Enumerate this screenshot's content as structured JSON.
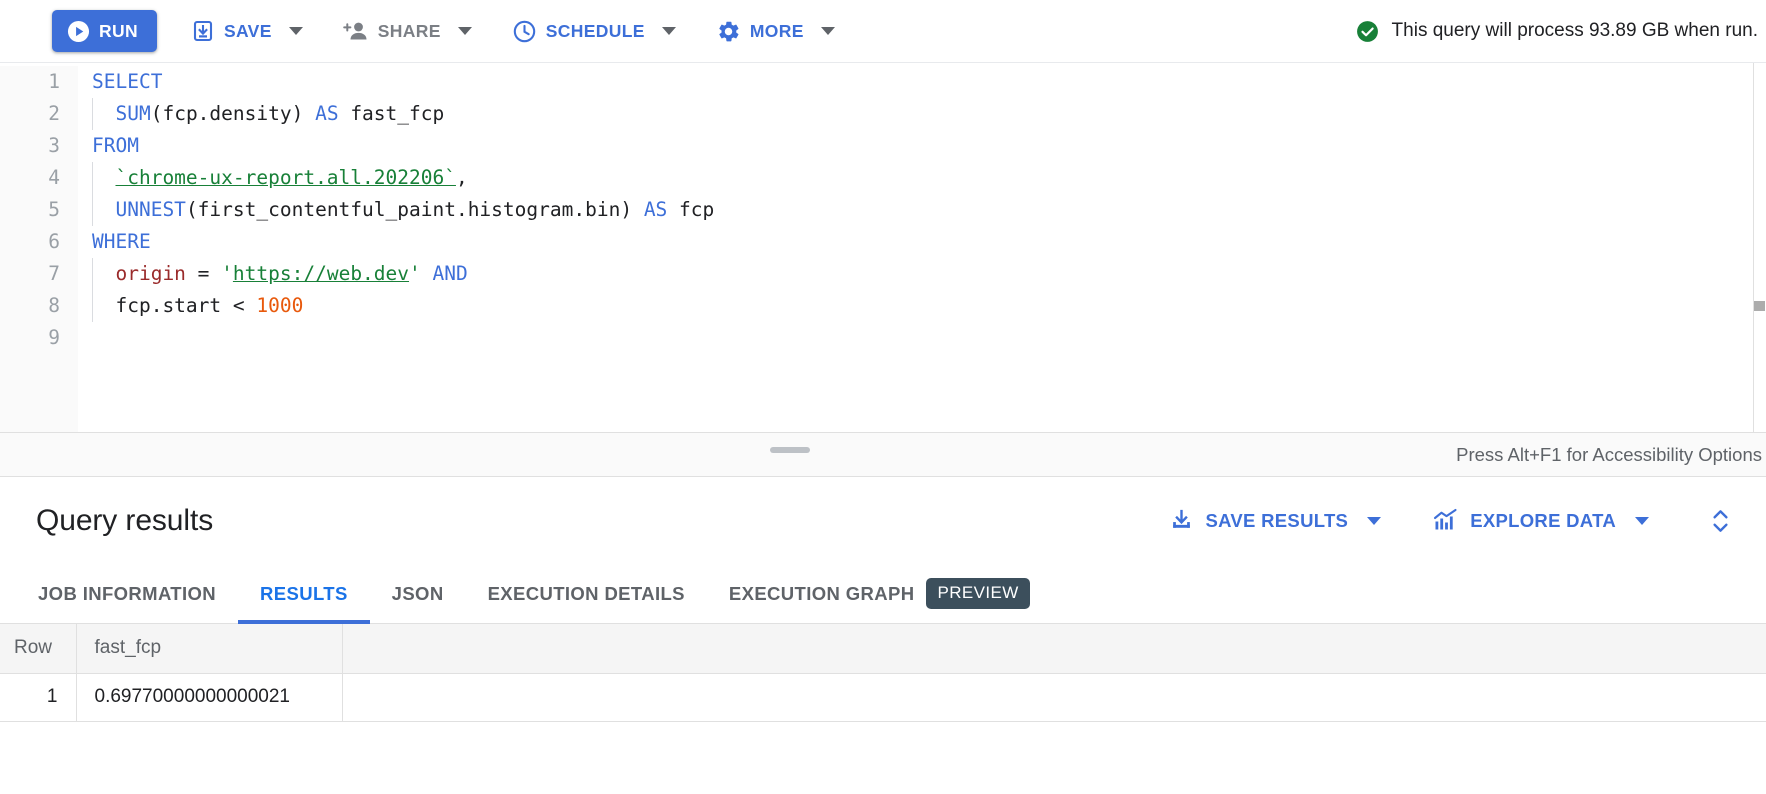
{
  "toolbar": {
    "run_label": "RUN",
    "save_label": "SAVE",
    "share_label": "SHARE",
    "schedule_label": "SCHEDULE",
    "more_label": "MORE",
    "status_text": "This query will process 93.89 GB when run.",
    "status_color": "#188038",
    "accent_color": "#3d6fd8"
  },
  "editor": {
    "line_numbers": [
      "1",
      "2",
      "3",
      "4",
      "5",
      "6",
      "7",
      "8",
      "9"
    ],
    "lines": [
      {
        "num": "1",
        "tokens": [
          {
            "t": "SELECT",
            "c": "kw"
          }
        ]
      },
      {
        "num": "2",
        "tokens": [
          {
            "t": "  ",
            "c": "plain"
          },
          {
            "t": "SUM",
            "c": "kw"
          },
          {
            "t": "(fcp.density) ",
            "c": "plain"
          },
          {
            "t": "AS",
            "c": "kw"
          },
          {
            "t": " fast_fcp",
            "c": "plain"
          }
        ]
      },
      {
        "num": "3",
        "tokens": [
          {
            "t": "FROM",
            "c": "kw"
          }
        ]
      },
      {
        "num": "4",
        "tokens": [
          {
            "t": "  ",
            "c": "plain"
          },
          {
            "t": "`chrome-ux-report.all.202206`",
            "c": "str"
          },
          {
            "t": ",",
            "c": "plain"
          }
        ]
      },
      {
        "num": "5",
        "tokens": [
          {
            "t": "  ",
            "c": "plain"
          },
          {
            "t": "UNNEST",
            "c": "kw"
          },
          {
            "t": "(first_contentful_paint.histogram.bin) ",
            "c": "plain"
          },
          {
            "t": "AS",
            "c": "kw"
          },
          {
            "t": " fcp",
            "c": "plain"
          }
        ]
      },
      {
        "num": "6",
        "tokens": [
          {
            "t": "WHERE",
            "c": "kw"
          }
        ]
      },
      {
        "num": "7",
        "tokens": [
          {
            "t": "  ",
            "c": "plain"
          },
          {
            "t": "origin",
            "c": "fld"
          },
          {
            "t": " = ",
            "c": "plain"
          },
          {
            "t": "'",
            "c": "strq"
          },
          {
            "t": "https://web.dev",
            "c": "str"
          },
          {
            "t": "'",
            "c": "strq"
          },
          {
            "t": " ",
            "c": "plain"
          },
          {
            "t": "AND",
            "c": "kw"
          }
        ]
      },
      {
        "num": "8",
        "tokens": [
          {
            "t": "  fcp.start < ",
            "c": "plain"
          },
          {
            "t": "1000",
            "c": "num"
          }
        ]
      },
      {
        "num": "9",
        "tokens": []
      }
    ],
    "full_query": "SELECT\n  SUM(fcp.density) AS fast_fcp\nFROM\n  `chrome-ux-report.all.202206`,\n  UNNEST(first_contentful_paint.histogram.bin) AS fcp\nWHERE\n  origin = 'https://web.dev' AND\n  fcp.start < 1000\n",
    "accessibility_hint": "Press Alt+F1 for Accessibility Options"
  },
  "results": {
    "title": "Query results",
    "save_results_label": "SAVE RESULTS",
    "explore_data_label": "EXPLORE DATA",
    "tabs": [
      {
        "label": "JOB INFORMATION",
        "active": false,
        "badge": ""
      },
      {
        "label": "RESULTS",
        "active": true,
        "badge": ""
      },
      {
        "label": "JSON",
        "active": false,
        "badge": ""
      },
      {
        "label": "EXECUTION DETAILS",
        "active": false,
        "badge": ""
      },
      {
        "label": "EXECUTION GRAPH",
        "active": false,
        "badge": "PREVIEW"
      }
    ],
    "table": {
      "headers": [
        "Row",
        "fast_fcp",
        ""
      ],
      "rows": [
        {
          "row": "1",
          "fast_fcp": "0.69770000000000021",
          "blank": ""
        }
      ]
    }
  }
}
